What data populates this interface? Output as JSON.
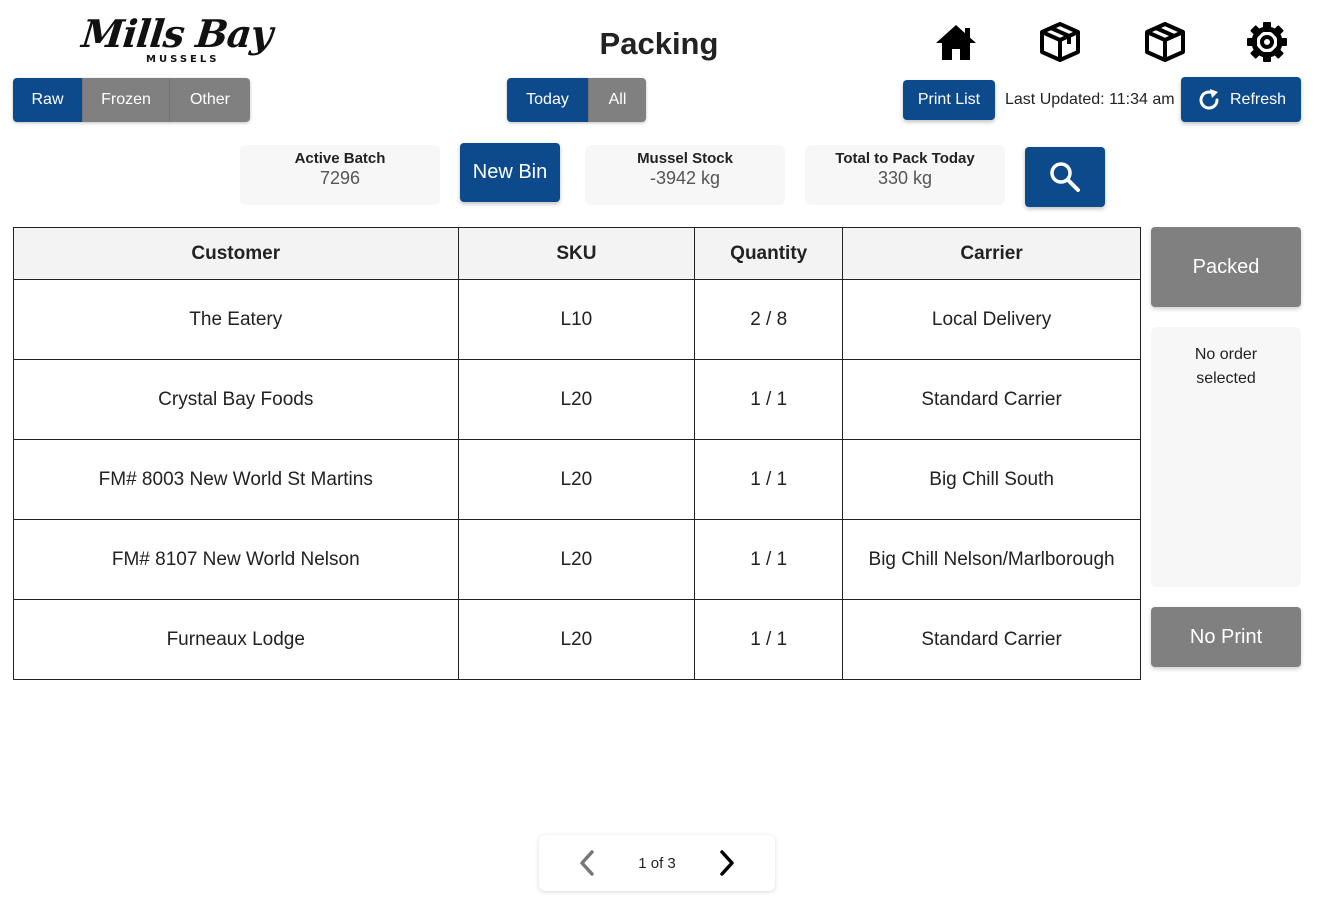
{
  "header": {
    "logo_script": "Mills Bay",
    "logo_sub": "MUSSELS",
    "title": "Packing",
    "icons": [
      "home-icon",
      "open-box-icon",
      "box-icon",
      "gear-icon"
    ]
  },
  "filters": {
    "category": {
      "options": [
        "Raw",
        "Frozen",
        "Other"
      ],
      "selected": "Raw"
    },
    "period": {
      "options": [
        "Today",
        "All"
      ],
      "selected": "Today"
    }
  },
  "toolbar": {
    "print_list": "Print List",
    "last_updated": "Last Updated: 11:34 am",
    "refresh": "Refresh",
    "new_bin": "New Bin"
  },
  "stats": {
    "active_batch": {
      "label": "Active Batch",
      "value": "7296"
    },
    "mussel_stock": {
      "label": "Mussel Stock",
      "value": "-3942 kg"
    },
    "total_to_pack": {
      "label": "Total to Pack Today",
      "value": "330 kg"
    }
  },
  "table": {
    "columns": [
      "Customer",
      "SKU",
      "Quantity",
      "Carrier"
    ],
    "rows": [
      [
        "The Eatery",
        "L10",
        "2 / 8",
        "Local Delivery"
      ],
      [
        "Crystal Bay Foods",
        "L20",
        "1 / 1",
        "Standard Carrier"
      ],
      [
        "FM# 8003 New World St Martins",
        "L20",
        "1 / 1",
        "Big Chill South"
      ],
      [
        "FM# 8107 New World Nelson",
        "L20",
        "1 / 1",
        "Big Chill Nelson/Marlborough"
      ],
      [
        "Furneaux Lodge",
        "L20",
        "1 / 1",
        "Standard Carrier"
      ]
    ]
  },
  "side": {
    "packed": "Packed",
    "no_order": "No order selected",
    "no_print": "No Print"
  },
  "pagination": {
    "label": "1 of 3"
  },
  "colors": {
    "primary": "#0c4a8c",
    "inactive": "#808080",
    "card_bg": "#f7f7f7"
  }
}
